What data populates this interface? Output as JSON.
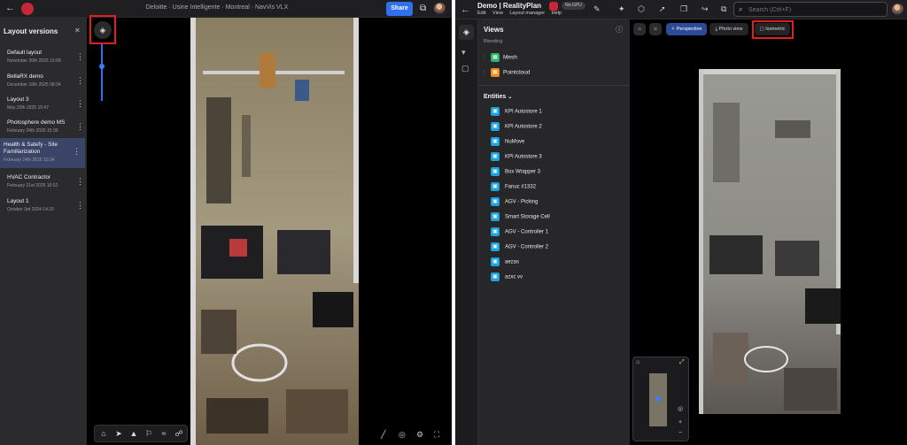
{
  "left": {
    "header": {
      "back_icon": "arrow-left-icon",
      "breadcrumb": "Deloitte · Usine Intelligente · Montreal · NavVis VLX",
      "share_label": "Share",
      "external_icon": "external-link-icon"
    },
    "sidebar": {
      "title": "Layout versions",
      "versions": [
        {
          "name": "Default layout",
          "date": "November 20th 2025 15:08"
        },
        {
          "name": "BellaRX demo",
          "date": "December 16th 2025 08:34"
        },
        {
          "name": "Layout 3",
          "date": "May 23th 2025 15:47"
        },
        {
          "name": "Photosphere demo MS",
          "date": "February 24th 2026 15:36"
        },
        {
          "name": "Health & Satefy - Site Familiarization",
          "date": "February 24th 2026 10:34"
        },
        {
          "name": "HVAC Contractor",
          "date": "February 21st 2025 16:52"
        },
        {
          "name": "Layout 1",
          "date": "October 3rd 2024 14:20"
        }
      ],
      "active_index": 4
    },
    "viewer": {
      "layer_button_icon": "layers-icon",
      "slider_level": 0.35,
      "toolbar_icons": [
        "home-icon",
        "send-icon",
        "marker-icon",
        "route-icon",
        "path-icon",
        "walk-icon"
      ],
      "bottom_right_icons": [
        "ruler-icon",
        "comment-icon",
        "settings-icon",
        "fullscreen-icon"
      ]
    }
  },
  "right": {
    "header": {
      "title": "Demo | RealityPlan",
      "badge": "No-GPU",
      "menu": [
        "Edit",
        "View",
        "Layout manager",
        "Help"
      ],
      "search_placeholder": "Search (Ctrl+F)"
    },
    "panel": {
      "views_title": "Views",
      "blending_label": "Blending",
      "views": [
        {
          "name": "Mesh",
          "icon": "mesh-icon",
          "color": "#2fb36b"
        },
        {
          "name": "Pointcloud",
          "icon": "pointcloud-icon",
          "color": "#f08a1a"
        }
      ],
      "entities_title": "Entities",
      "entities": [
        "KPI Autostore 1",
        "KPI Autostore 2",
        "NuMove",
        "KPI Autostore 3",
        "Box Wrapper 3",
        "Fanuc #1332",
        "AGV - Picking",
        "Smart Storage Cell",
        "AGV - Controller 1",
        "AGV - Controller 2",
        "aezas",
        "azxc vv"
      ]
    },
    "viewer": {
      "buttons": [
        "Perspective",
        "Photo view",
        "Isometric"
      ],
      "active_button": "Perspective"
    }
  },
  "colors": {
    "accent": "#2f6ff0",
    "highlight_box": "#e02020",
    "entity": "#1aa3df",
    "brand": "#c62838"
  }
}
